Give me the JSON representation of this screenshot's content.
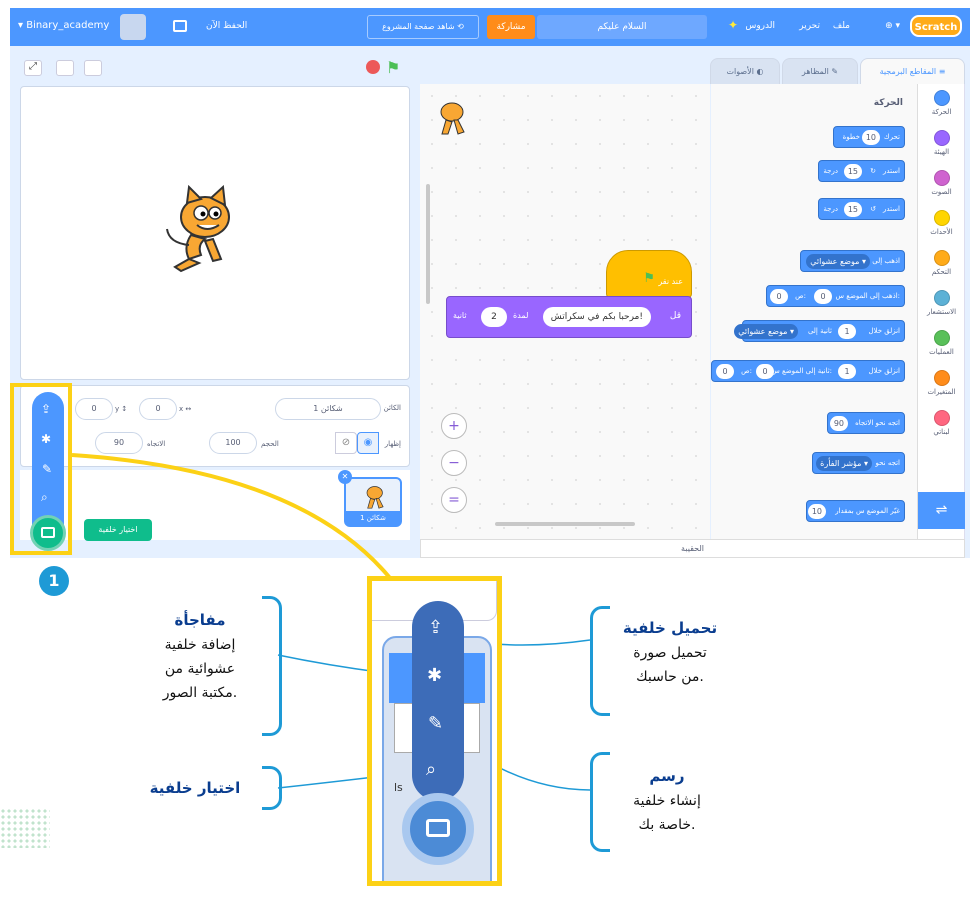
{
  "topbar": {
    "logo": "Scratch",
    "file": "ملف",
    "edit": "تحرير",
    "tutorials": "الدروس",
    "project_title": "السلام عليكم",
    "share": "مشاركة",
    "see_project": "شاهد صفحة المشروع",
    "save_now": "الحفظ الآن",
    "username": "Binary_academy"
  },
  "tabs": {
    "code": "المقاطع البرمجية",
    "costumes": "المظاهر",
    "sounds": "الأصوات"
  },
  "categories": [
    {
      "label": "الحركة",
      "color": "#4c97ff"
    },
    {
      "label": "الهيئة",
      "color": "#9966ff"
    },
    {
      "label": "الصوت",
      "color": "#cf63cf"
    },
    {
      "label": "الأحداث",
      "color": "#ffd500"
    },
    {
      "label": "التحكم",
      "color": "#ffab19"
    },
    {
      "label": "الاستشعار",
      "color": "#5cb1d6"
    },
    {
      "label": "العمليات",
      "color": "#59c059"
    },
    {
      "label": "المتغيرات",
      "color": "#ff8c1a"
    },
    {
      "label": "لبناتي",
      "color": "#ff6680"
    }
  ],
  "palette": {
    "heading": "الحركة",
    "move": {
      "text": "تحرك",
      "value": "10",
      "suffix": "خطوة"
    },
    "turn_right": {
      "text": "استدر",
      "value": "15",
      "suffix": "درجة"
    },
    "turn_left": {
      "text": "استدر",
      "value": "15",
      "suffix": "درجة"
    },
    "goto": {
      "text": "اذهب إلى",
      "dropdown": "موضع عشوائي"
    },
    "goto_xy": {
      "text": "اذهب إلى الموضع س:",
      "x": "0",
      "y_label": "ص:",
      "y": "0"
    },
    "glide": {
      "text": "انزلق خلال",
      "value": "1",
      "mid": "ثانية إلى",
      "dropdown": "موضع عشوائي"
    },
    "glide_xy": {
      "text": "انزلق خلال",
      "value": "1",
      "mid": "ثانية إلى الموضع س:",
      "x": "0",
      "y_label": "ص:",
      "y": "0"
    },
    "point_dir": {
      "text": "اتجه نحو الاتجاه",
      "value": "90"
    },
    "point_towards": {
      "text": "اتجه نحو",
      "dropdown": "مؤشر الفأرة"
    },
    "change_x": {
      "text": "غيّر الموضع س بمقدار",
      "value": "10"
    }
  },
  "script": {
    "hat": "عند نقر",
    "say_prefix": "قل",
    "say_text": "مرحبا بكم في سكراتش!",
    "duration_label": "لمدة",
    "duration": "2",
    "seconds": "ثانية"
  },
  "backpack": "الحقيبة",
  "sprite_info": {
    "sprite_label": "الكائن",
    "sprite_name": "شكائن 1",
    "x": "0",
    "y": "0",
    "show_label": "إظهار",
    "size_label": "الحجم",
    "size": "100",
    "direction_label": "الاتجاه",
    "direction": "90"
  },
  "sprite_thumb": "شكائن 1",
  "tooltip": "اختيار خلفية",
  "badge": "1",
  "callouts": {
    "upload_title": "تحميل خلفية",
    "upload_desc1": "تحميل صورة",
    "upload_desc2": "من حاسبك.",
    "surprise_title": "مفاجأة",
    "surprise_desc1": "إضافة خلفية",
    "surprise_desc2": "عشوائية من",
    "surprise_desc3": "مكتبة الصور.",
    "paint_title": "رسم",
    "paint_desc1": "إنشاء خلفية",
    "paint_desc2": "خاصة بك.",
    "choose_title": "اختيار خلفية"
  },
  "zoom_partial_text": "ls"
}
